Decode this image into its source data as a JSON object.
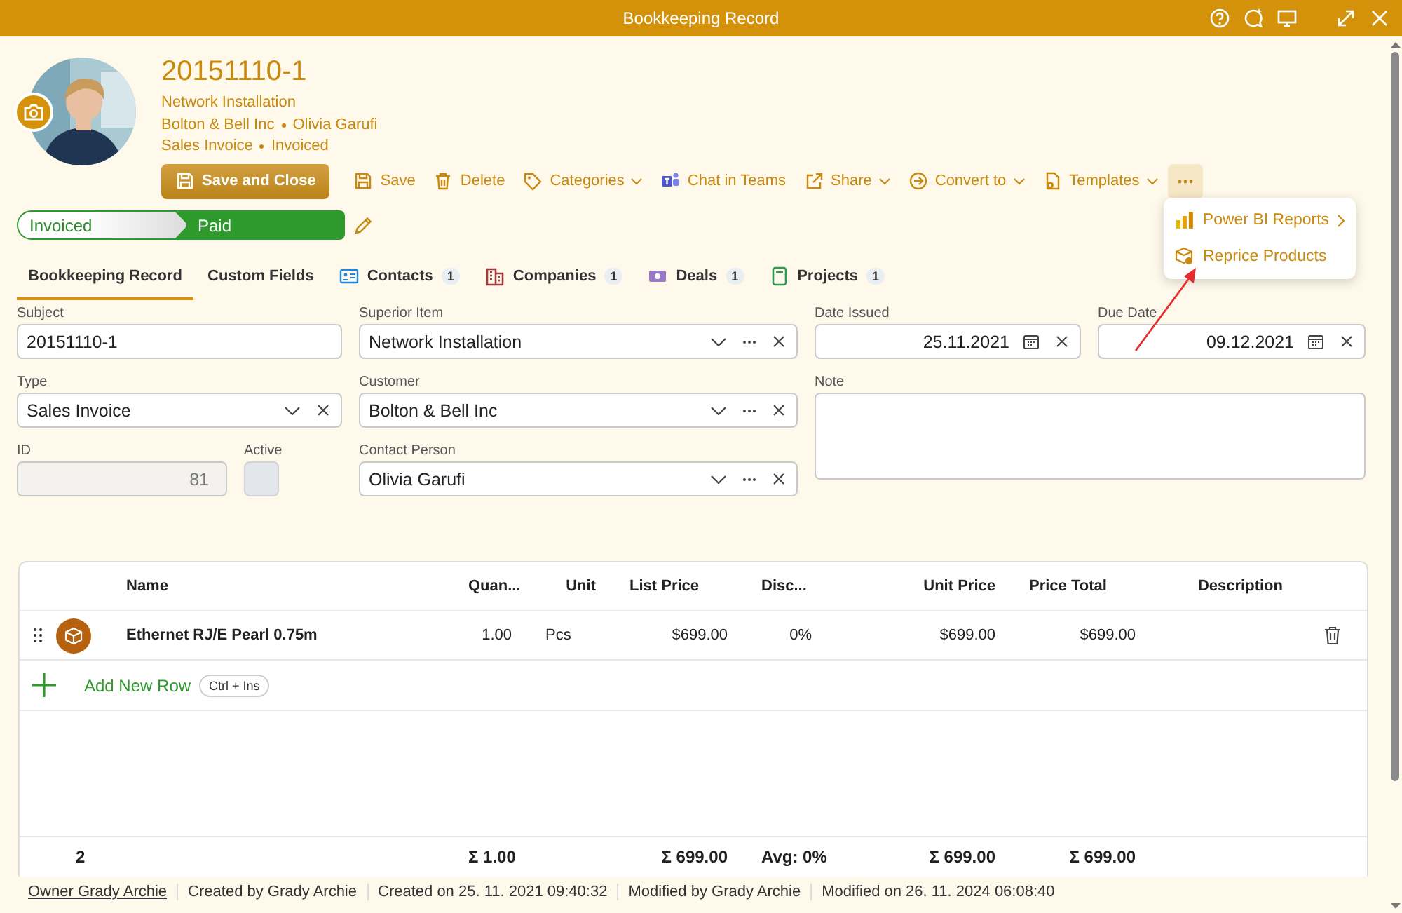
{
  "window": {
    "title": "Bookkeeping Record"
  },
  "header": {
    "title": "20151110-1",
    "avatar": {
      "kind": "picture"
    },
    "lines": [
      [
        "Network Installation"
      ],
      [
        "Bolton & Bell Inc",
        "Olivia Garufi"
      ],
      [
        "Sales Invoice",
        "Invoiced"
      ]
    ]
  },
  "toolbar": [
    {
      "label": "Save and Close",
      "kind": "primary"
    },
    {
      "label": "Save",
      "kind": "button"
    },
    {
      "label": "Delete",
      "kind": "button"
    },
    {
      "label": "Categories",
      "kind": "dropdown"
    },
    {
      "label": "Chat in Teams",
      "kind": "button"
    },
    {
      "label": "Share",
      "kind": "dropdown"
    },
    {
      "label": "Convert to",
      "kind": "dropdown"
    },
    {
      "label": "Templates",
      "kind": "dropdown"
    },
    {
      "kind": "more"
    }
  ],
  "more_menu": {
    "open": true,
    "items": [
      {
        "label": "Power BI Reports",
        "submenu": true
      },
      {
        "label": "Reprice Products",
        "submenu": false
      }
    ]
  },
  "stages": [
    {
      "label": "Invoiced",
      "selected": false
    },
    {
      "label": "Paid",
      "selected": true
    }
  ],
  "tabs": [
    {
      "label": "Bookkeeping Record",
      "selected": true
    },
    {
      "label": "Custom Fields",
      "selected": false
    },
    {
      "label": "Contacts",
      "count": "1",
      "selected": false
    },
    {
      "label": "Companies",
      "count": "1",
      "selected": false
    },
    {
      "label": "Deals",
      "count": "1",
      "selected": false
    },
    {
      "label": "Projects",
      "count": "1",
      "selected": false
    }
  ],
  "fields": [
    {
      "label": "Subject",
      "kind": "text",
      "value": "20151110-1"
    },
    {
      "label": "Superior Item",
      "kind": "lookup",
      "value": "Network Installation"
    },
    {
      "label": "Date Issued",
      "kind": "date",
      "value": "25.11.2021"
    },
    {
      "label": "Due Date",
      "kind": "date",
      "value": "09.12.2021"
    },
    {
      "label": "Type",
      "kind": "select",
      "value": "Sales Invoice"
    },
    {
      "label": "Customer",
      "kind": "lookup",
      "value": "Bolton & Bell Inc"
    },
    {
      "label": "Note",
      "kind": "textarea"
    },
    {
      "label": "ID",
      "kind": "number",
      "value": "81",
      "disabled": true
    },
    {
      "label": "Active",
      "kind": "checkbox",
      "checked": false
    },
    {
      "label": "Contact Person",
      "kind": "lookup",
      "value": "Olivia Garufi"
    }
  ],
  "items_grid": {
    "columns": [
      "Name",
      "Quan...",
      "Unit",
      "List Price",
      "Disc...",
      "Unit Price",
      "Price Total",
      "Description"
    ],
    "rows": [
      {
        "name": "Ethernet RJ/E Pearl 0.75m",
        "quantity": "1.00",
        "unit": "Pcs",
        "list_price": "$699.00",
        "discount": "0%",
        "unit_price": "$699.00",
        "price_total": "$699.00"
      }
    ],
    "add_row": {
      "label": "Add New Row",
      "shortcut": "Ctrl + Ins"
    },
    "totals": {
      "count": "2",
      "quantity": "Σ 1.00",
      "list_price": "Σ 699.00",
      "discount": "Avg: 0%",
      "unit_price": "Σ 699.00",
      "price_total": "Σ 699.00"
    }
  },
  "status_bar": [
    {
      "text": "Owner Grady Archie",
      "kind": "link"
    },
    {
      "text": "Created by Grady Archie",
      "kind": "text"
    },
    {
      "text": "Created on 25. 11. 2021 09:40:32",
      "kind": "text"
    },
    {
      "text": "Modified by Grady Archie",
      "kind": "text"
    },
    {
      "text": "Modified on 26. 11. 2024 06:08:40",
      "kind": "text"
    }
  ]
}
